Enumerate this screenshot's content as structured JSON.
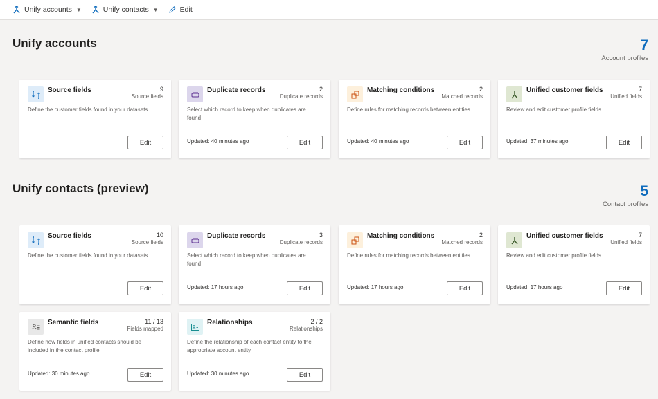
{
  "toolbar": {
    "items": [
      {
        "label": "Unify accounts",
        "icon": "unify-icon"
      },
      {
        "label": "Unify contacts",
        "icon": "unify-icon"
      },
      {
        "label": "Edit",
        "icon": "pencil-icon"
      }
    ]
  },
  "accounts": {
    "title": "Unify accounts",
    "profile_count": "7",
    "profile_label": "Account profiles",
    "cards": [
      {
        "title": "Source fields",
        "count": "9",
        "unit": "Source fields",
        "desc": "Define the customer fields found in your datasets",
        "updated": "",
        "edit": "Edit",
        "icon": "source-fields-icon"
      },
      {
        "title": "Duplicate records",
        "count": "2",
        "unit": "Duplicate records",
        "desc": "Select which record to keep when duplicates are found",
        "updated": "Updated: 40 minutes ago",
        "edit": "Edit",
        "icon": "duplicate-records-icon"
      },
      {
        "title": "Matching conditions",
        "count": "2",
        "unit": "Matched records",
        "desc": "Define rules for matching records between entities",
        "updated": "Updated: 40 minutes ago",
        "edit": "Edit",
        "icon": "matching-conditions-icon"
      },
      {
        "title": "Unified customer fields",
        "count": "7",
        "unit": "Unified fields",
        "desc": "Review and edit customer profile fields",
        "updated": "Updated: 37 minutes ago",
        "edit": "Edit",
        "icon": "unified-fields-icon"
      }
    ]
  },
  "contacts": {
    "title": "Unify contacts (preview)",
    "profile_count": "5",
    "profile_label": "Contact profiles",
    "cards": [
      {
        "title": "Source fields",
        "count": "10",
        "unit": "Source fields",
        "desc": "Define the customer fields found in your datasets",
        "updated": "",
        "edit": "Edit",
        "icon": "source-fields-icon"
      },
      {
        "title": "Duplicate records",
        "count": "3",
        "unit": "Duplicate records",
        "desc": "Select which record to keep when duplicates are found",
        "updated": "Updated: 17 hours ago",
        "edit": "Edit",
        "icon": "duplicate-records-icon"
      },
      {
        "title": "Matching conditions",
        "count": "2",
        "unit": "Matched records",
        "desc": "Define rules for matching records between entities",
        "updated": "Updated: 17 hours ago",
        "edit": "Edit",
        "icon": "matching-conditions-icon"
      },
      {
        "title": "Unified customer fields",
        "count": "7",
        "unit": "Unified fields",
        "desc": "Review and edit customer profile fields",
        "updated": "Updated: 17 hours ago",
        "edit": "Edit",
        "icon": "unified-fields-icon"
      },
      {
        "title": "Semantic fields",
        "count": "11 / 13",
        "unit": "Fields mapped",
        "desc": "Define how fields in unified contacts should be included in the contact profile",
        "updated": "Updated: 30 minutes ago",
        "edit": "Edit",
        "icon": "semantic-fields-icon"
      },
      {
        "title": "Relationships",
        "count": "2 / 2",
        "unit": "Relationships",
        "desc": "Define the relationship of each contact entity to the appropriate account entity",
        "updated": "Updated: 30 minutes ago",
        "edit": "Edit",
        "icon": "relationships-icon"
      }
    ]
  },
  "colors": {
    "accent": "#0f6cbd",
    "background": "#f4f3f2",
    "card": "#ffffff"
  }
}
